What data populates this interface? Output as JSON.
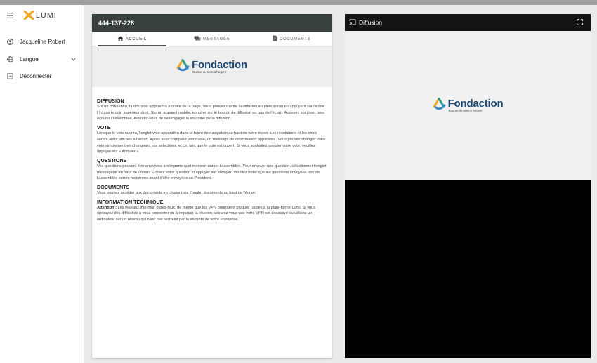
{
  "sidebar": {
    "brand": "LUMI",
    "user_name": "Jacqueline Robert",
    "language_label": "Langue",
    "logout_label": "Déconnecter"
  },
  "meeting": {
    "id": "444-137-228"
  },
  "tabs": [
    {
      "label": "ACCUEIL",
      "active": true
    },
    {
      "label": "MESSAGES",
      "active": false
    },
    {
      "label": "DOCUMENTS",
      "active": false
    }
  ],
  "logo": {
    "name": "Fondaction",
    "tagline": "Donner du sens à l'argent"
  },
  "sections": {
    "diffusion": {
      "title": "DIFFUSION",
      "body": "Sur un ordinateur, la diffusion apparaîtra à droite de la page. Vous pouvez mettre la diffusion en plein écran en appuyant sur l'icône [ ] dans le coin supérieur droit. Sur un appareil mobile, appuyer sur le bouton de diffusion au bas de l'écran. Appuyez sur jouer pour écouter l'assemblée. Assurez-vous de désengager la sourdine de la diffusion."
    },
    "vote": {
      "title": "VOTE",
      "body": "Lorsque le vote ouvrira, l'onglet vote apparaîtra dans la barre de navigation au haut de votre écran. Les résolutions et les choix seront alors affichés à l'écran. Après avoir complété votre vote, un message de confirmation apparaîtra. Vous pouvez changer votre vote simplement en changeant vos sélections, et ce, tant que le vote est ouvert. Si vous souhaitez annuler votre vote, veuillez appuyer sur « Annuler »."
    },
    "questions": {
      "title": "QUESTIONS",
      "body": "Vos questions peuvent être envoyées à n'importe quel moment durant l'assemblée. Pour envoyer une question, sélectionner l'onglet messagerie en haut de l'écran. Écrivez votre question et appuyer sur envoyer. Veuillez noter que les questions envoyées lors de l'assemblée seront modérées avant d'être envoyées au Président."
    },
    "documents": {
      "title": "DOCUMENTS",
      "body": "Vous pouvez accéder aux documents en cliquant sur l'onglet documents au haut de l'écran."
    },
    "technique": {
      "title": "INFORMATION TECHNIQUE",
      "attention_label": "Attention :",
      "body": " Les réseaux internes, pares-feux, de même que les VPN pourraient bloquer l'accès à la plate-forme Lumi. Si vous éprouvez des difficultés à vous connecter ou à regarder la réunion, assurez vous que votre VPN est désactivé ou utilisez un ordinateur sur un réseau qui n'est pas restreint par la sécurité de votre entreprise."
    }
  },
  "diffusion_panel": {
    "title": "Diffusion"
  },
  "colors": {
    "header_dark": "#384140",
    "logo_blue": "#1d4a72",
    "lumi_orange": "#f2a623"
  },
  "icons": [
    "menu-icon",
    "account-icon",
    "globe-icon",
    "logout-icon",
    "home-icon",
    "messages-icon",
    "document-icon",
    "cast-icon",
    "fullscreen-icon"
  ]
}
